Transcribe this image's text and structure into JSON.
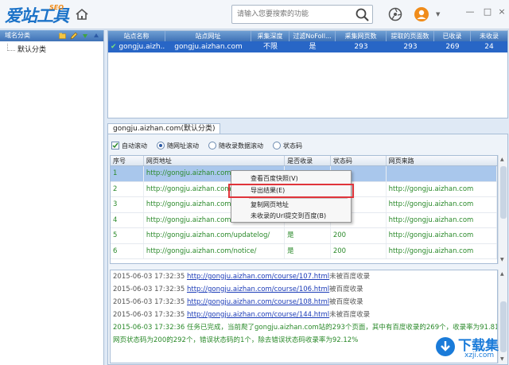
{
  "app": {
    "logo_main": "爱站工具包",
    "logo_seo": "SEO",
    "search_placeholder": "请输入您要搜索的功能"
  },
  "left_panel": {
    "title": "域名分类",
    "tree_items": [
      "默认分类"
    ]
  },
  "site_table": {
    "columns": [
      "站点名称",
      "站点网址",
      "采集深度",
      "过滤NoFoll...",
      "采集网页数",
      "提取的页面数",
      "已收录",
      "未收录"
    ],
    "rows": [
      [
        "gongju.aizh...",
        "gongju.aizhan.com",
        "不限",
        "是",
        "293",
        "293",
        "269",
        "24"
      ]
    ]
  },
  "tab": {
    "label": "gongju.aizhan.com(默认分类)"
  },
  "options": {
    "auto_scroll": "自动滚动",
    "radio_follow_url": "随网址滚动",
    "radio_follow_index": "随收录数据滚动",
    "radio_status": "状态码"
  },
  "url_table": {
    "columns": [
      "序号",
      "网页地址",
      "是否收录",
      "状态码",
      "网页来路"
    ],
    "rows": [
      {
        "num": "1",
        "url": "http://gongju.aizhan.com",
        "indexed": "",
        "status": "",
        "source": ""
      },
      {
        "num": "2",
        "url": "http://gongju.aizhan.com/",
        "indexed": "",
        "status": "",
        "source": "http://gongju.aizhan.com"
      },
      {
        "num": "3",
        "url": "http://gongju.aizhan.com/",
        "indexed": "",
        "status": "",
        "source": "http://gongju.aizhan.com"
      },
      {
        "num": "4",
        "url": "http://gongju.aizhan.com/",
        "indexed": "",
        "status": "",
        "source": "http://gongju.aizhan.com"
      },
      {
        "num": "5",
        "url": "http://gongju.aizhan.com/updatelog/",
        "indexed": "是",
        "status": "200",
        "source": "http://gongju.aizhan.com"
      },
      {
        "num": "6",
        "url": "http://gongju.aizhan.com/notice/",
        "indexed": "是",
        "status": "200",
        "source": "http://gongju.aizhan.com"
      }
    ]
  },
  "context_menu": {
    "items": [
      "查看百度快照(V)",
      "导出结果(E)",
      "复制网页地址",
      "未收录的Url提交到百度(B)"
    ]
  },
  "log": {
    "lines": [
      {
        "ts": "2015-06-03 17:32:35",
        "url": "http://gongju.aizhan.com/course/107.html",
        "msg": "未被百度收录"
      },
      {
        "ts": "2015-06-03 17:32:35",
        "url": "http://gongju.aizhan.com/course/106.html",
        "msg": "被百度收录"
      },
      {
        "ts": "2015-06-03 17:32:35",
        "url": "http://gongju.aizhan.com/course/108.html",
        "msg": "被百度收录"
      },
      {
        "ts": "2015-06-03 17:32:35",
        "url": "http://gongju.aizhan.com/course/144.html",
        "msg": "未被百度收录"
      }
    ],
    "summary_1": "2015-06-03 17:32:36 任务已完成，当前爬了gongju.aizhan.com站的293个页面，其中有百度收录的269个，收录率为91.81%,",
    "summary_2": "网页状态码为200的292个，错误状态码的1个，除去错误状态码收录率为92.12%"
  },
  "watermark": {
    "text": "下载集",
    "url": "xzji.com"
  },
  "colors": {
    "header_bg": "#f3f6fa",
    "grid_header_blue": "#3f72b7",
    "selected_row": "#2866c6",
    "url_green": "#2b8a2b",
    "link_blue": "#1a3ab7",
    "highlight_red": "#e0343a"
  }
}
